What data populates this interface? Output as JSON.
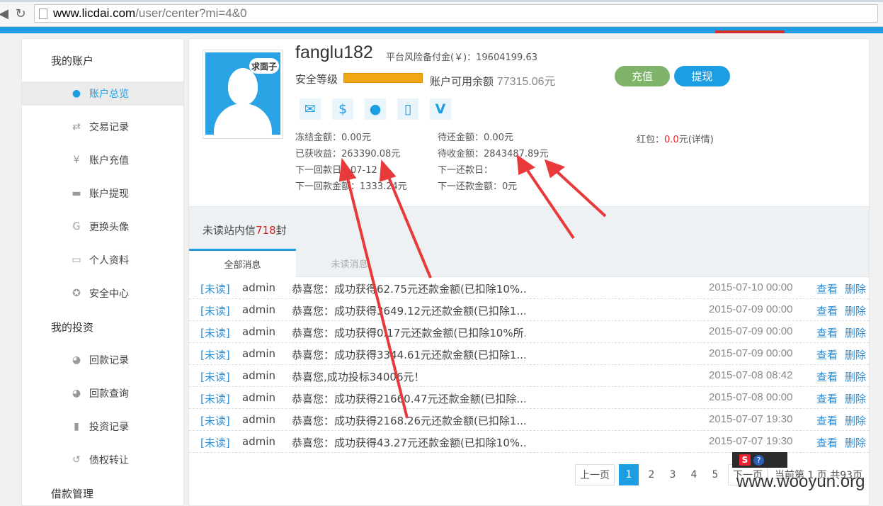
{
  "browser": {
    "url_host": "www.licdai.com",
    "url_path": "/user/center?mi=4&0"
  },
  "sidebar": {
    "group1": "我的账户",
    "group2": "我的投资",
    "group3": "借款管理",
    "items": [
      {
        "label": "账户总览",
        "icon": "user-icon",
        "active": true
      },
      {
        "label": "交易记录",
        "icon": "swap-icon"
      },
      {
        "label": "账户充值",
        "icon": "yen-icon"
      },
      {
        "label": "账户提现",
        "icon": "card-icon"
      },
      {
        "label": "更换头像",
        "icon": "g-icon"
      },
      {
        "label": "个人资料",
        "icon": "profile-icon"
      },
      {
        "label": "安全中心",
        "icon": "star-icon"
      },
      {
        "label": "回款记录",
        "icon": "pie-icon"
      },
      {
        "label": "回款查询",
        "icon": "pie-icon"
      },
      {
        "label": "投资记录",
        "icon": "doc-icon"
      },
      {
        "label": "债权转让",
        "icon": "undo-icon"
      }
    ]
  },
  "profile": {
    "avatar_bubble": "求面子",
    "username": "fanglu182",
    "fund": "平台风险备付金(￥)：19604199.63",
    "security_label": "安全等级",
    "balance_label": "账户可用余额",
    "balance_value": "77315.06元",
    "recharge_label": "充值",
    "withdraw_label": "提现"
  },
  "stats": {
    "frozen": "冻结金额：0.00元",
    "earned": "已获收益：263390.08元",
    "next_return_date": "下一回款日：07-12",
    "next_return_amount": "下一回款金额：1333.24元",
    "to_repay": "待还金额：0.00元",
    "to_collect": "待收金额：2843487.89元",
    "next_repay_date": "下一还款日：",
    "next_repay_amount": "下一还款金额：0元",
    "redpacket_prefix": "红包：",
    "redpacket_value": "0.0",
    "redpacket_suffix": "元(详情)"
  },
  "messages": {
    "unread_prefix": "未读站内信",
    "unread_count": "718",
    "unread_suffix": "封",
    "tab_all": "全部消息",
    "tab_unread": "未读消息",
    "view_label": "查看",
    "delete_label": "删除",
    "rows": [
      {
        "tag": "[未读]",
        "sender": "admin",
        "msg": "恭喜您：成功获得62.75元还款金额(已扣除10%...",
        "time": "2015-07-10 00:00"
      },
      {
        "tag": "[未读]",
        "sender": "admin",
        "msg": "恭喜您：成功获得3649.12元还款金额(已扣除1...",
        "time": "2015-07-09 00:00"
      },
      {
        "tag": "[未读]",
        "sender": "admin",
        "msg": "恭喜您：成功获得0.17元还款金额(已扣除10%所...",
        "time": "2015-07-09 00:00"
      },
      {
        "tag": "[未读]",
        "sender": "admin",
        "msg": "恭喜您：成功获得3344.61元还款金额(已扣除1...",
        "time": "2015-07-09 00:00"
      },
      {
        "tag": "[未读]",
        "sender": "admin",
        "msg": "恭喜您,成功投标34006元！",
        "time": "2015-07-08 08:42"
      },
      {
        "tag": "[未读]",
        "sender": "admin",
        "msg": "恭喜您：成功获得21660.47元还款金额(已扣除...",
        "time": "2015-07-08 00:00"
      },
      {
        "tag": "[未读]",
        "sender": "admin",
        "msg": "恭喜您：成功获得2168.26元还款金额(已扣除1...",
        "time": "2015-07-07 19:30"
      },
      {
        "tag": "[未读]",
        "sender": "admin",
        "msg": "恭喜您：成功获得43.27元还款金额(已扣除10%...",
        "time": "2015-07-07 19:30"
      }
    ]
  },
  "pager": {
    "prev": "上一页",
    "pages": [
      "1",
      "2",
      "3",
      "4",
      "5"
    ],
    "next": "下一页",
    "info": "当前第 1 页 共93页"
  },
  "watermark": "www.wooyun.org",
  "colors": {
    "accent": "#1e9ee2",
    "recharge": "#7fb36a",
    "security_bar": "#f3a614",
    "annotation": "#e83a3a"
  }
}
